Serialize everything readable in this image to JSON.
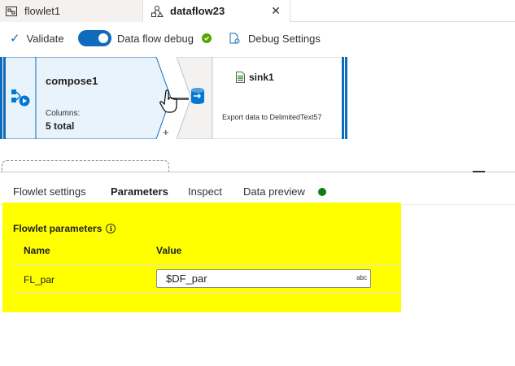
{
  "tabs": [
    {
      "label": "flowlet1",
      "icon": "flowlet-icon",
      "active": false
    },
    {
      "label": "dataflow23",
      "icon": "dataflow-icon",
      "active": true
    }
  ],
  "toolbar": {
    "validate_label": "Validate",
    "debug_label": "Data flow debug",
    "debug_on": true,
    "debug_settings_label": "Debug Settings"
  },
  "canvas": {
    "source_node": {
      "title": "compose1",
      "columns_label": "Columns:",
      "columns_value": "5 total",
      "add_label": "+"
    },
    "sink_node": {
      "title": "sink1",
      "description": "Export data to DelimitedText57"
    }
  },
  "panel": {
    "tabs": [
      "Flowlet settings",
      "Parameters",
      "Inspect",
      "Data preview"
    ],
    "active_tab": "Parameters",
    "section_title": "Flowlet parameters",
    "columns": {
      "name": "Name",
      "value": "Value"
    },
    "rows": [
      {
        "name": "FL_par",
        "value": "$DF_par",
        "type": "abc"
      }
    ]
  },
  "colors": {
    "accent": "#0f6cbd",
    "status_ok": "#57a300",
    "highlight": "#ffff00"
  }
}
